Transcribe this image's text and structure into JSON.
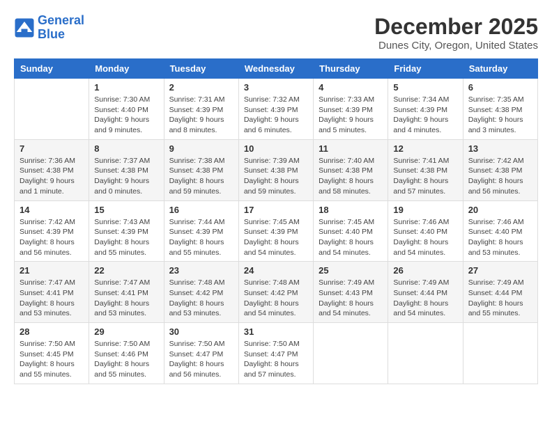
{
  "logo": {
    "line1": "General",
    "line2": "Blue"
  },
  "title": "December 2025",
  "subtitle": "Dunes City, Oregon, United States",
  "days_header": [
    "Sunday",
    "Monday",
    "Tuesday",
    "Wednesday",
    "Thursday",
    "Friday",
    "Saturday"
  ],
  "weeks": [
    [
      {
        "day": "",
        "info": ""
      },
      {
        "day": "1",
        "info": "Sunrise: 7:30 AM\nSunset: 4:40 PM\nDaylight: 9 hours\nand 9 minutes."
      },
      {
        "day": "2",
        "info": "Sunrise: 7:31 AM\nSunset: 4:39 PM\nDaylight: 9 hours\nand 8 minutes."
      },
      {
        "day": "3",
        "info": "Sunrise: 7:32 AM\nSunset: 4:39 PM\nDaylight: 9 hours\nand 6 minutes."
      },
      {
        "day": "4",
        "info": "Sunrise: 7:33 AM\nSunset: 4:39 PM\nDaylight: 9 hours\nand 5 minutes."
      },
      {
        "day": "5",
        "info": "Sunrise: 7:34 AM\nSunset: 4:39 PM\nDaylight: 9 hours\nand 4 minutes."
      },
      {
        "day": "6",
        "info": "Sunrise: 7:35 AM\nSunset: 4:38 PM\nDaylight: 9 hours\nand 3 minutes."
      }
    ],
    [
      {
        "day": "7",
        "info": "Sunrise: 7:36 AM\nSunset: 4:38 PM\nDaylight: 9 hours\nand 1 minute."
      },
      {
        "day": "8",
        "info": "Sunrise: 7:37 AM\nSunset: 4:38 PM\nDaylight: 9 hours\nand 0 minutes."
      },
      {
        "day": "9",
        "info": "Sunrise: 7:38 AM\nSunset: 4:38 PM\nDaylight: 8 hours\nand 59 minutes."
      },
      {
        "day": "10",
        "info": "Sunrise: 7:39 AM\nSunset: 4:38 PM\nDaylight: 8 hours\nand 59 minutes."
      },
      {
        "day": "11",
        "info": "Sunrise: 7:40 AM\nSunset: 4:38 PM\nDaylight: 8 hours\nand 58 minutes."
      },
      {
        "day": "12",
        "info": "Sunrise: 7:41 AM\nSunset: 4:38 PM\nDaylight: 8 hours\nand 57 minutes."
      },
      {
        "day": "13",
        "info": "Sunrise: 7:42 AM\nSunset: 4:38 PM\nDaylight: 8 hours\nand 56 minutes."
      }
    ],
    [
      {
        "day": "14",
        "info": "Sunrise: 7:42 AM\nSunset: 4:39 PM\nDaylight: 8 hours\nand 56 minutes."
      },
      {
        "day": "15",
        "info": "Sunrise: 7:43 AM\nSunset: 4:39 PM\nDaylight: 8 hours\nand 55 minutes."
      },
      {
        "day": "16",
        "info": "Sunrise: 7:44 AM\nSunset: 4:39 PM\nDaylight: 8 hours\nand 55 minutes."
      },
      {
        "day": "17",
        "info": "Sunrise: 7:45 AM\nSunset: 4:39 PM\nDaylight: 8 hours\nand 54 minutes."
      },
      {
        "day": "18",
        "info": "Sunrise: 7:45 AM\nSunset: 4:40 PM\nDaylight: 8 hours\nand 54 minutes."
      },
      {
        "day": "19",
        "info": "Sunrise: 7:46 AM\nSunset: 4:40 PM\nDaylight: 8 hours\nand 54 minutes."
      },
      {
        "day": "20",
        "info": "Sunrise: 7:46 AM\nSunset: 4:40 PM\nDaylight: 8 hours\nand 53 minutes."
      }
    ],
    [
      {
        "day": "21",
        "info": "Sunrise: 7:47 AM\nSunset: 4:41 PM\nDaylight: 8 hours\nand 53 minutes."
      },
      {
        "day": "22",
        "info": "Sunrise: 7:47 AM\nSunset: 4:41 PM\nDaylight: 8 hours\nand 53 minutes."
      },
      {
        "day": "23",
        "info": "Sunrise: 7:48 AM\nSunset: 4:42 PM\nDaylight: 8 hours\nand 53 minutes."
      },
      {
        "day": "24",
        "info": "Sunrise: 7:48 AM\nSunset: 4:42 PM\nDaylight: 8 hours\nand 54 minutes."
      },
      {
        "day": "25",
        "info": "Sunrise: 7:49 AM\nSunset: 4:43 PM\nDaylight: 8 hours\nand 54 minutes."
      },
      {
        "day": "26",
        "info": "Sunrise: 7:49 AM\nSunset: 4:44 PM\nDaylight: 8 hours\nand 54 minutes."
      },
      {
        "day": "27",
        "info": "Sunrise: 7:49 AM\nSunset: 4:44 PM\nDaylight: 8 hours\nand 55 minutes."
      }
    ],
    [
      {
        "day": "28",
        "info": "Sunrise: 7:50 AM\nSunset: 4:45 PM\nDaylight: 8 hours\nand 55 minutes."
      },
      {
        "day": "29",
        "info": "Sunrise: 7:50 AM\nSunset: 4:46 PM\nDaylight: 8 hours\nand 55 minutes."
      },
      {
        "day": "30",
        "info": "Sunrise: 7:50 AM\nSunset: 4:47 PM\nDaylight: 8 hours\nand 56 minutes."
      },
      {
        "day": "31",
        "info": "Sunrise: 7:50 AM\nSunset: 4:47 PM\nDaylight: 8 hours\nand 57 minutes."
      },
      {
        "day": "",
        "info": ""
      },
      {
        "day": "",
        "info": ""
      },
      {
        "day": "",
        "info": ""
      }
    ]
  ]
}
